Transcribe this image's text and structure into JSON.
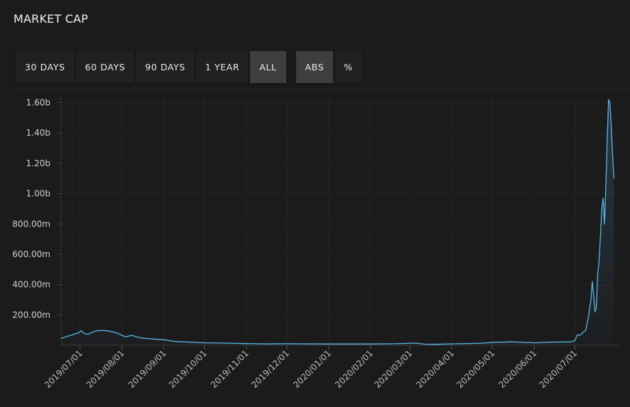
{
  "header": {
    "title": "MARKET CAP"
  },
  "toolbar": {
    "range_buttons": [
      {
        "label": "30 DAYS",
        "active": false
      },
      {
        "label": "60 DAYS",
        "active": false
      },
      {
        "label": "90 DAYS",
        "active": false
      },
      {
        "label": "1 YEAR",
        "active": false
      },
      {
        "label": "ALL",
        "active": true
      }
    ],
    "mode_buttons": [
      {
        "label": "ABS",
        "active": true
      },
      {
        "label": "%",
        "active": false
      }
    ]
  },
  "colors": {
    "line": "#5bb6e6",
    "background": "#1b1b1c",
    "grid": "#262627"
  },
  "chart_data": {
    "type": "area",
    "title": "MARKET CAP",
    "xlabel": "",
    "ylabel": "",
    "ylim": [
      0,
      1640000000
    ],
    "xlim": [
      "2019-06-17",
      "2020-08-03"
    ],
    "grid": true,
    "y_ticks": [
      {
        "value": 200000000,
        "label": "200.00m"
      },
      {
        "value": 400000000,
        "label": "400.00m"
      },
      {
        "value": 600000000,
        "label": "600.00m"
      },
      {
        "value": 800000000,
        "label": "800.00m"
      },
      {
        "value": 1000000000,
        "label": "1.00b"
      },
      {
        "value": 1200000000,
        "label": "1.20b"
      },
      {
        "value": 1400000000,
        "label": "1.40b"
      },
      {
        "value": 1600000000,
        "label": "1.60b"
      }
    ],
    "x_ticks": [
      {
        "date": "2019-07-01",
        "label": "2019/07/01"
      },
      {
        "date": "2019-08-01",
        "label": "2019/08/01"
      },
      {
        "date": "2019-09-01",
        "label": "2019/09/01"
      },
      {
        "date": "2019-10-01",
        "label": "2019/10/01"
      },
      {
        "date": "2019-11-01",
        "label": "2019/11/01"
      },
      {
        "date": "2019-12-01",
        "label": "2019/12/01"
      },
      {
        "date": "2020-01-01",
        "label": "2020/01/01"
      },
      {
        "date": "2020-02-01",
        "label": "2020/02/01"
      },
      {
        "date": "2020-03-01",
        "label": "2020/03/01"
      },
      {
        "date": "2020-04-01",
        "label": "2020/04/01"
      },
      {
        "date": "2020-05-01",
        "label": "2020/05/01"
      },
      {
        "date": "2020-06-01",
        "label": "2020/06/01"
      },
      {
        "date": "2020-07-01",
        "label": "2020/07/01"
      }
    ],
    "series": [
      {
        "points": [
          [
            "2019-06-17",
            45000000
          ],
          [
            "2019-06-24",
            65000000
          ],
          [
            "2019-06-30",
            82000000
          ],
          [
            "2019-07-02",
            95000000
          ],
          [
            "2019-07-04",
            78000000
          ],
          [
            "2019-07-07",
            72000000
          ],
          [
            "2019-07-10",
            85000000
          ],
          [
            "2019-07-13",
            95000000
          ],
          [
            "2019-07-17",
            98000000
          ],
          [
            "2019-07-21",
            95000000
          ],
          [
            "2019-07-25",
            88000000
          ],
          [
            "2019-07-28",
            82000000
          ],
          [
            "2019-08-01",
            65000000
          ],
          [
            "2019-08-04",
            55000000
          ],
          [
            "2019-08-08",
            65000000
          ],
          [
            "2019-08-11",
            58000000
          ],
          [
            "2019-08-15",
            48000000
          ],
          [
            "2019-08-22",
            42000000
          ],
          [
            "2019-09-01",
            36000000
          ],
          [
            "2019-09-10",
            24000000
          ],
          [
            "2019-09-20",
            20000000
          ],
          [
            "2019-10-01",
            16000000
          ],
          [
            "2019-10-15",
            14000000
          ],
          [
            "2019-11-01",
            11000000
          ],
          [
            "2019-11-15",
            9000000
          ],
          [
            "2019-12-01",
            10000000
          ],
          [
            "2020-01-01",
            8000000
          ],
          [
            "2020-02-01",
            8000000
          ],
          [
            "2020-02-20",
            10000000
          ],
          [
            "2020-03-05",
            14000000
          ],
          [
            "2020-03-12",
            7000000
          ],
          [
            "2020-03-20",
            6000000
          ],
          [
            "2020-04-01",
            9000000
          ],
          [
            "2020-04-20",
            12000000
          ],
          [
            "2020-05-01",
            18000000
          ],
          [
            "2020-05-15",
            22000000
          ],
          [
            "2020-06-01",
            16000000
          ],
          [
            "2020-06-15",
            20000000
          ],
          [
            "2020-06-28",
            22000000
          ],
          [
            "2020-07-01",
            30000000
          ],
          [
            "2020-07-03",
            70000000
          ],
          [
            "2020-07-05",
            65000000
          ],
          [
            "2020-07-07",
            85000000
          ],
          [
            "2020-07-09",
            95000000
          ],
          [
            "2020-07-11",
            180000000
          ],
          [
            "2020-07-13",
            300000000
          ],
          [
            "2020-07-14",
            420000000
          ],
          [
            "2020-07-15",
            330000000
          ],
          [
            "2020-07-16",
            220000000
          ],
          [
            "2020-07-17",
            250000000
          ],
          [
            "2020-07-18",
            470000000
          ],
          [
            "2020-07-19",
            560000000
          ],
          [
            "2020-07-20",
            720000000
          ],
          [
            "2020-07-21",
            900000000
          ],
          [
            "2020-07-22",
            970000000
          ],
          [
            "2020-07-23",
            800000000
          ],
          [
            "2020-07-24",
            1050000000
          ],
          [
            "2020-07-25",
            1350000000
          ],
          [
            "2020-07-26",
            1620000000
          ],
          [
            "2020-07-27",
            1600000000
          ],
          [
            "2020-07-28",
            1450000000
          ],
          [
            "2020-07-29",
            1250000000
          ],
          [
            "2020-07-30",
            1100000000
          ]
        ]
      }
    ]
  }
}
